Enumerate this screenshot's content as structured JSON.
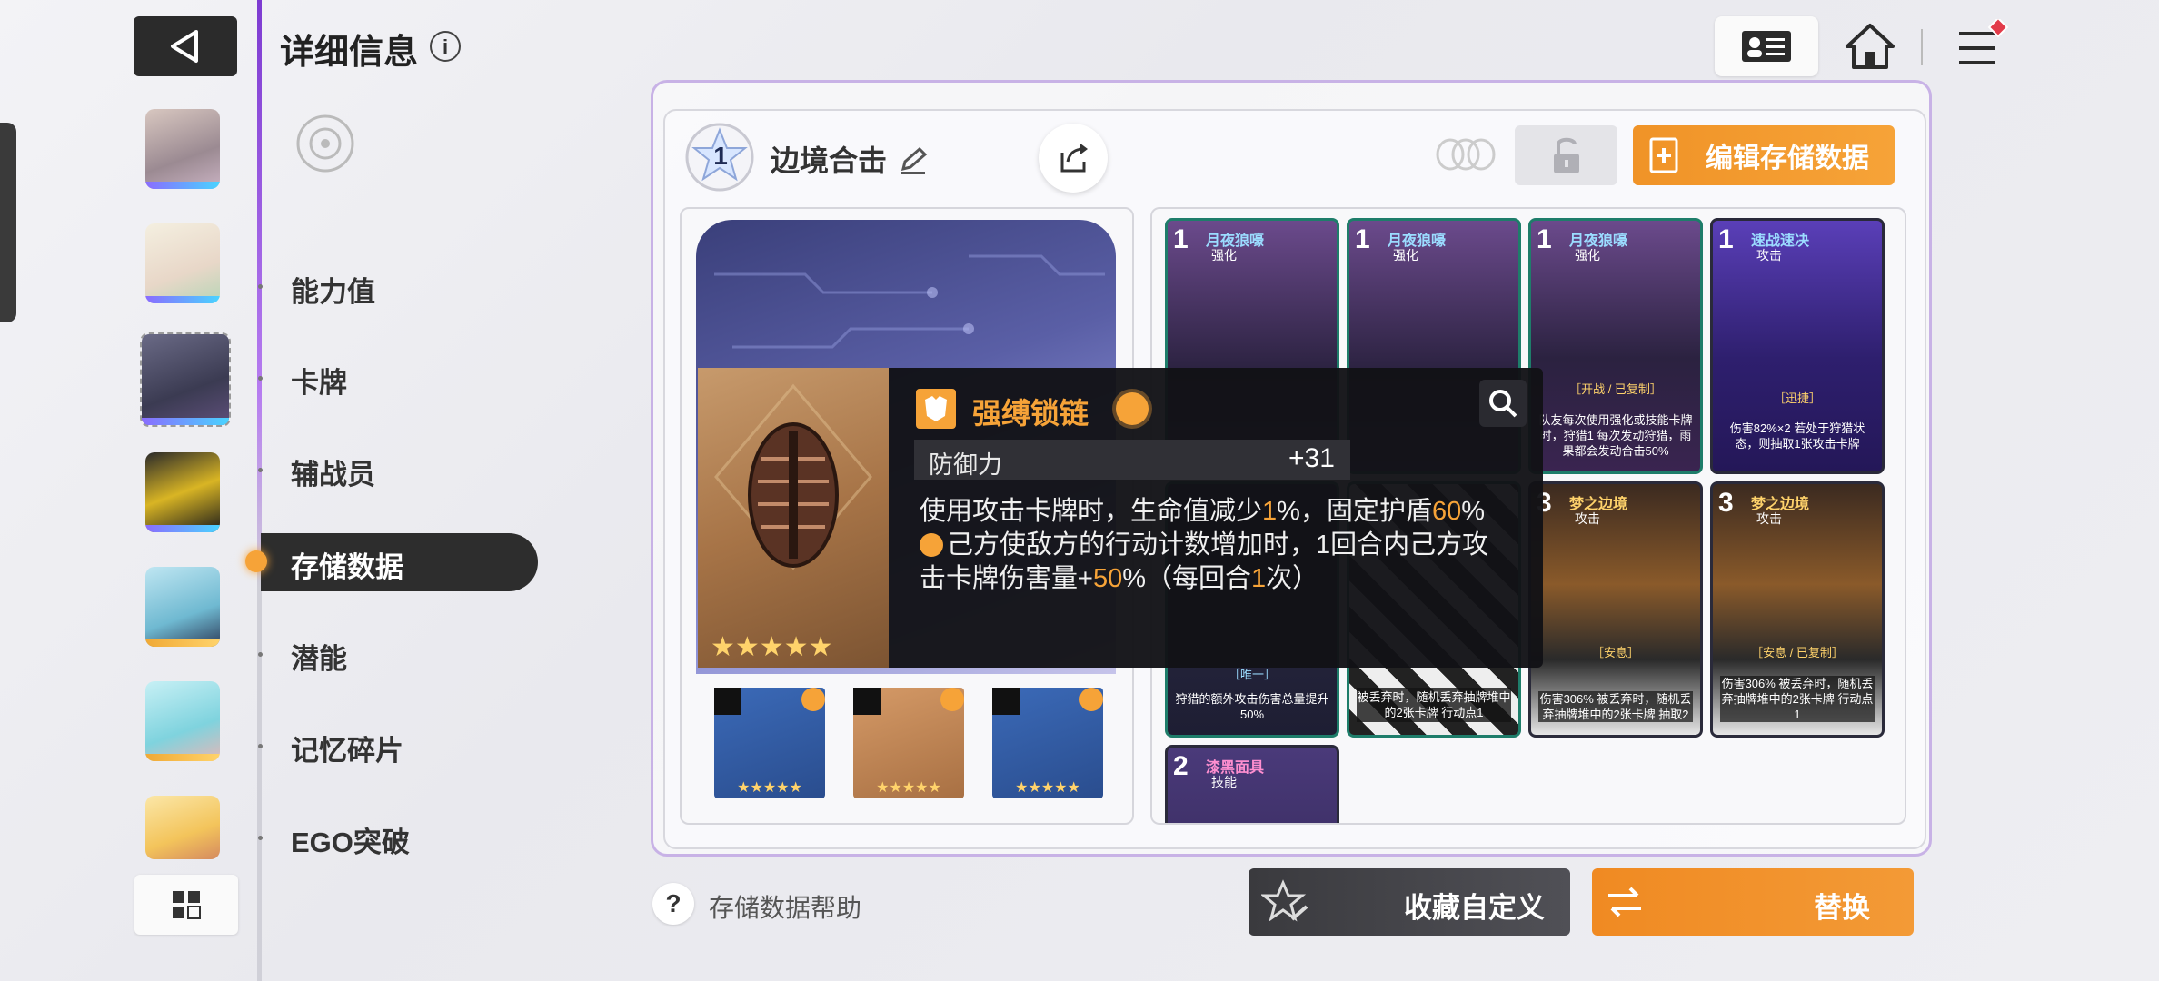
{
  "header": {
    "title": "详细信息",
    "info_icon": "i"
  },
  "sidebar": {
    "items": [
      {
        "label": "能力值",
        "active": false
      },
      {
        "label": "卡牌",
        "active": false
      },
      {
        "label": "辅战员",
        "active": false
      },
      {
        "label": "存储数据",
        "active": true
      },
      {
        "label": "潜能",
        "active": false
      },
      {
        "label": "记忆碎片",
        "active": false
      },
      {
        "label": "EGO突破",
        "active": false
      }
    ]
  },
  "data_panel": {
    "level": "1",
    "name": "边境合击",
    "edit_button": "编辑存储数据"
  },
  "tooltip": {
    "item_name": "强缚锁链",
    "stat_label": "防御力",
    "stat_value": "+31",
    "desc_line1_a": "使用攻击卡牌时，生命值减少",
    "desc_line1_b": "1",
    "desc_line1_c": "%，固定护盾",
    "desc_line1_d": "60",
    "desc_line1_e": "%",
    "desc_line2": "己方使敌方的行动计数增加时，1回合内己方攻",
    "desc_line3_a": "击卡牌伤害量+",
    "desc_line3_b": "50",
    "desc_line3_c": "%（每回合",
    "desc_line3_d": "1",
    "desc_line3_e": "次）",
    "stars": "★★★★★"
  },
  "cards": [
    {
      "cost": "1",
      "name": "月夜狼嚎",
      "type": "强化",
      "tag": "",
      "desc": ""
    },
    {
      "cost": "1",
      "name": "月夜狼嚎",
      "type": "强化",
      "tag": "",
      "desc": ""
    },
    {
      "cost": "1",
      "name": "月夜狼嚎",
      "type": "强化",
      "tag": "［开战 / 已复制］",
      "desc": "队友每次使用强化或技能卡牌时，狩猎1 每次发动狩猎，雨果都会发动合击50%"
    },
    {
      "cost": "1",
      "name": "速战速决",
      "type": "攻击",
      "tag": "［迅捷］",
      "desc": "伤害82%×2 若处于狩猎状态，则抽取1张攻击卡牌"
    },
    {
      "cost": "",
      "name": "",
      "type": "",
      "tag": "［唯一］",
      "desc": "狩猎的额外攻击伤害总量提升50%"
    },
    {
      "cost": "",
      "name": "",
      "type": "",
      "tag": "",
      "desc": "被丢弃时，随机丢弃抽牌堆中的2张卡牌 行动点1"
    },
    {
      "cost": "3",
      "name": "梦之边境",
      "type": "攻击",
      "tag": "［安息］",
      "desc": "伤害306% 被丢弃时，随机丢弃抽牌堆中的2张卡牌 抽取2"
    },
    {
      "cost": "3",
      "name": "梦之边境",
      "type": "攻击",
      "tag": "［安息 / 已复制］",
      "desc": "伤害306% 被丢弃时，随机丢弃抽牌堆中的2张卡牌 行动点1"
    },
    {
      "cost": "2",
      "name": "漆黑面具",
      "type": "技能",
      "tag": "",
      "desc": ""
    }
  ],
  "equipment": [
    {
      "stars": "★★★★★"
    },
    {
      "stars": "★★★★★"
    },
    {
      "stars": "★★★★★"
    }
  ],
  "footer": {
    "help_icon": "?",
    "help_text": "存储数据帮助",
    "favorite_button": "收藏自定义",
    "replace_button": "替换"
  }
}
